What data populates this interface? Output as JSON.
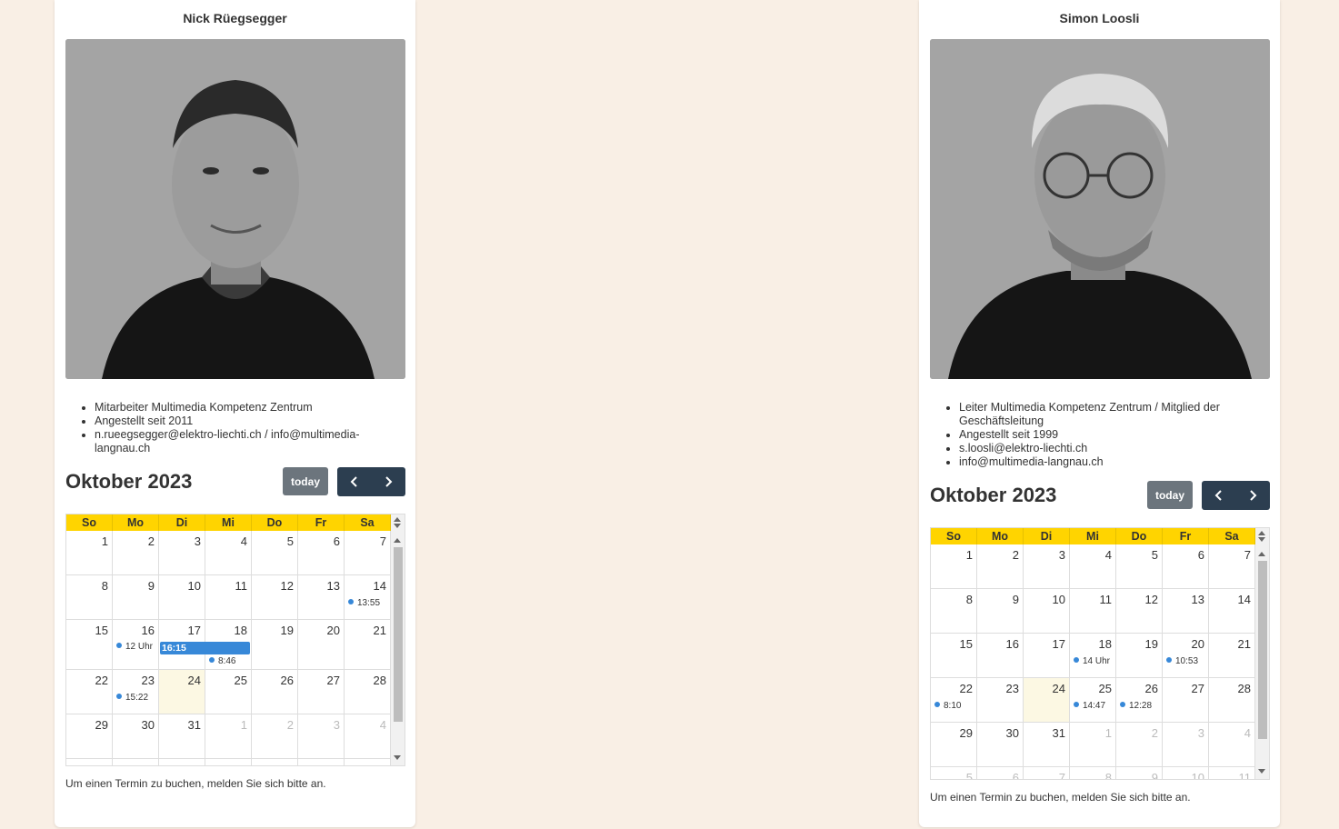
{
  "weekdays": [
    "So",
    "Mo",
    "Di",
    "Mi",
    "Do",
    "Fr",
    "Sa"
  ],
  "note": "Um einen Termin zu buchen, melden Sie sich bitte an.",
  "today_label": "today",
  "event_color": "#3788d8",
  "header_color": "#ffd400",
  "left": {
    "name": "Nick Rüegsegger",
    "info": [
      "Mitarbeiter Multimedia Kompetenz Zentrum",
      "Angestellt seit 2011",
      "n.rueegsegger@elektro-liechti.ch / info@multimedia-langnau.ch"
    ],
    "month_title": "Oktober 2023",
    "events": {
      "d14": "13:55",
      "d16": "12 Uhr",
      "d17_bar": "16:15",
      "d18": "8:46",
      "d23": "15:22"
    }
  },
  "right": {
    "name": "Simon Loosli",
    "info": [
      "Leiter Multimedia Kompetenz Zentrum / Mitglied der Geschäftsleitung",
      "Angestellt seit 1999",
      "s.loosli@elektro-liechti.ch",
      "info@multimedia-langnau.ch"
    ],
    "month_title": "Oktober 2023",
    "events": {
      "d18": "14 Uhr",
      "d20": "10:53",
      "d22": "8:10",
      "d25": "14:47",
      "d26": "12:28"
    }
  }
}
